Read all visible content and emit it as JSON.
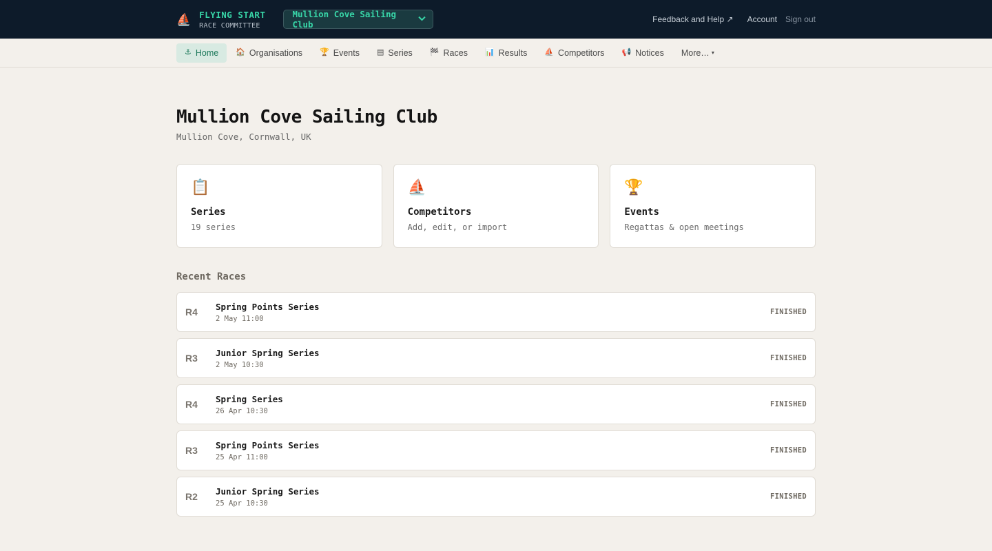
{
  "header": {
    "brand_icon": "⛵",
    "brand_title": "FLYING START",
    "brand_subtitle": "RACE COMMITTEE",
    "org_selector": {
      "value": "Mullion Cove Sailing Club",
      "chevron": "⌄"
    },
    "links": {
      "feedback": "Feedback and Help ↗",
      "account": "Account",
      "sign_out": "Sign out"
    }
  },
  "nav": {
    "items": [
      {
        "icon": "⚓",
        "label": "Home",
        "active": true
      },
      {
        "icon": "🏠",
        "label": "Organisations"
      },
      {
        "icon": "🏆",
        "label": "Events"
      },
      {
        "icon": "▤",
        "label": "Series"
      },
      {
        "icon": "🏁",
        "label": "Races"
      },
      {
        "icon": "📊",
        "label": "Results"
      },
      {
        "icon": "⛵",
        "label": "Competitors"
      },
      {
        "icon": "📢",
        "label": "Notices"
      },
      {
        "icon": "",
        "label": "More…",
        "caret": "▾"
      }
    ]
  },
  "page": {
    "title": "Mullion Cove Sailing Club",
    "subtitle": "Mullion Cove, Cornwall, UK"
  },
  "cards": [
    {
      "icon": "📋",
      "title": "Series",
      "subtitle": "19 series"
    },
    {
      "icon": "⛵",
      "title": "Competitors",
      "subtitle": "Add, edit, or import"
    },
    {
      "icon": "🏆",
      "title": "Events",
      "subtitle": "Regattas & open meetings"
    }
  ],
  "recent_races": {
    "title": "Recent Races",
    "items": [
      {
        "num": "R4",
        "name": "Spring Points Series",
        "time": "2 May 11:00",
        "status": "FINISHED"
      },
      {
        "num": "R3",
        "name": "Junior Spring Series",
        "time": "2 May 10:30",
        "status": "FINISHED"
      },
      {
        "num": "R4",
        "name": "Spring Series",
        "time": "26 Apr 10:30",
        "status": "FINISHED"
      },
      {
        "num": "R3",
        "name": "Spring Points Series",
        "time": "25 Apr 11:00",
        "status": "FINISHED"
      },
      {
        "num": "R2",
        "name": "Junior Spring Series",
        "time": "25 Apr 10:30",
        "status": "FINISHED"
      }
    ]
  }
}
